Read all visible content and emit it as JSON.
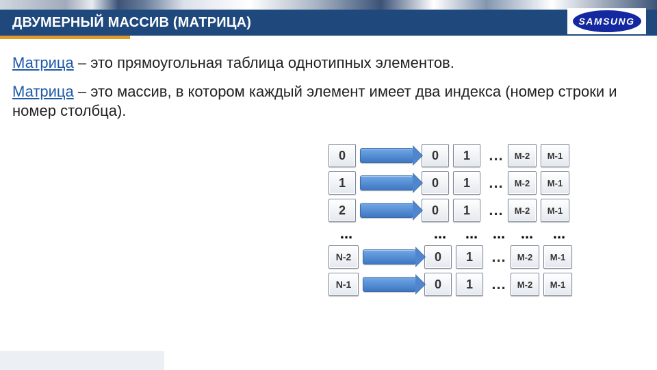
{
  "header": {
    "title": "ДВУМЕРНЫЙ МАССИВ  (МАТРИЦА)",
    "logo_text": "SAMSUNG"
  },
  "defs": [
    {
      "term": "Матрица",
      "text": " – это прямоугольная таблица однотипных элементов."
    },
    {
      "term": "Матрица",
      "text": " – это массив, в котором каждый элемент имеет два индекса (номер строки и номер столбца)."
    }
  ],
  "diagram": {
    "row_labels": [
      "0",
      "1",
      "2"
    ],
    "row_labels_bottom": [
      "N-2",
      "N-1"
    ],
    "col_first": [
      "0",
      "1"
    ],
    "col_last": [
      "M-2",
      "M-1"
    ],
    "ellipsis": "..."
  }
}
